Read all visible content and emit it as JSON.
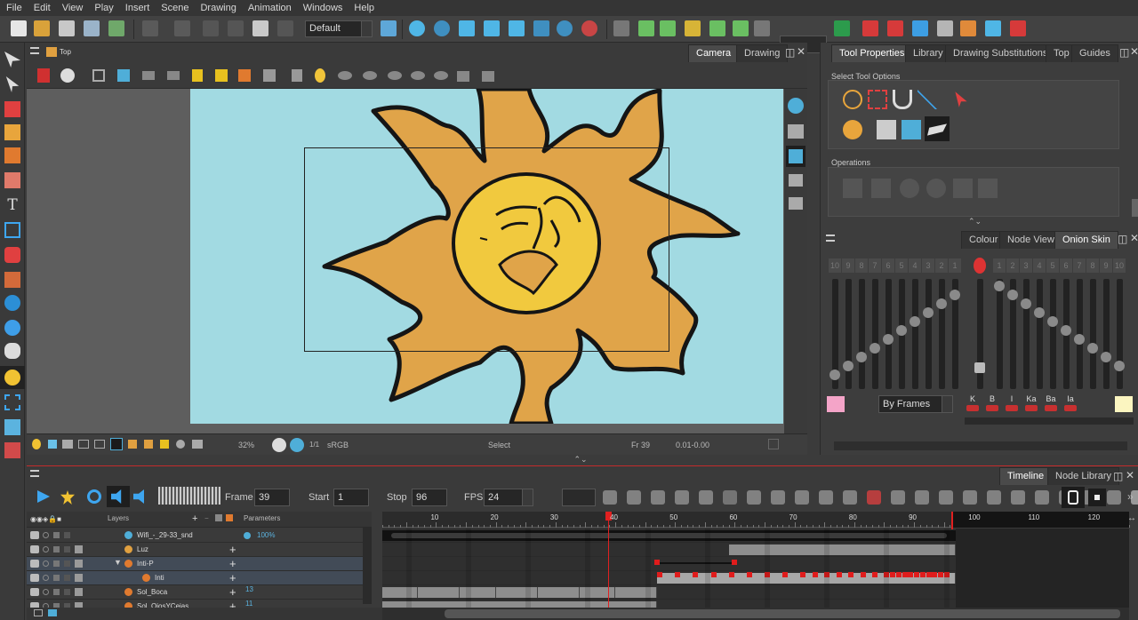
{
  "menu": [
    "File",
    "Edit",
    "View",
    "Play",
    "Insert",
    "Scene",
    "Drawing",
    "Animation",
    "Windows",
    "Help"
  ],
  "toolbar": {
    "workspace_preset": "Default"
  },
  "camera_view": {
    "breadcrumb": "Top",
    "tabs": [
      "Camera",
      "Drawing"
    ],
    "active_tab": "Camera",
    "status": {
      "zoom": "32%",
      "color_space": "sRGB",
      "tool": "Select",
      "frame": "Fr 39",
      "coords": "0.01-0.00",
      "ratio": "1/1"
    }
  },
  "tool_properties": {
    "tabs": [
      "Tool Properties",
      "Library",
      "Drawing Substitutions",
      "Top",
      "Guides"
    ],
    "active_tab": "Tool Properties",
    "select_tool_options_label": "Select Tool Options",
    "operations_label": "Operations"
  },
  "onion_skin": {
    "tabs": [
      "Colour",
      "Node View",
      "Onion Skin"
    ],
    "active_tab": "Onion Skin",
    "before_numbers": [
      "10",
      "9",
      "8",
      "7",
      "6",
      "5",
      "4",
      "3",
      "2",
      "1"
    ],
    "after_numbers": [
      "1",
      "2",
      "3",
      "4",
      "5",
      "6",
      "7",
      "8",
      "9",
      "10"
    ],
    "mode": "By Frames",
    "buttons": [
      "K",
      "B",
      "I",
      "Ka",
      "Ba",
      "Ia"
    ],
    "before_color": "#f4a4c8",
    "after_color": "#fbf5c0"
  },
  "timeline": {
    "tabs": [
      "Timeline",
      "Node Library"
    ],
    "active_tab": "Timeline",
    "frame_label": "Frame",
    "frame": "39",
    "start_label": "Start",
    "start": "1",
    "stop_label": "Stop",
    "stop": "96",
    "fps_label": "FPS",
    "fps": "24",
    "layers_label": "Layers",
    "parameters_label": "Parameters",
    "ruler": [
      "10",
      "20",
      "30",
      "40",
      "50",
      "60",
      "70",
      "80",
      "90",
      "100",
      "110",
      "120"
    ],
    "current_frame": 39,
    "scene_end": 96,
    "layers": [
      {
        "name": "Wifi_-_29-33_snd",
        "param": "100%"
      },
      {
        "name": "Luz",
        "param": ""
      },
      {
        "name": "Inti-P",
        "param": ""
      },
      {
        "name": "Inti",
        "param": ""
      },
      {
        "name": "Sol_Boca",
        "param": "13"
      },
      {
        "name": "Sol_OjosYCejas",
        "param": "11"
      }
    ]
  }
}
